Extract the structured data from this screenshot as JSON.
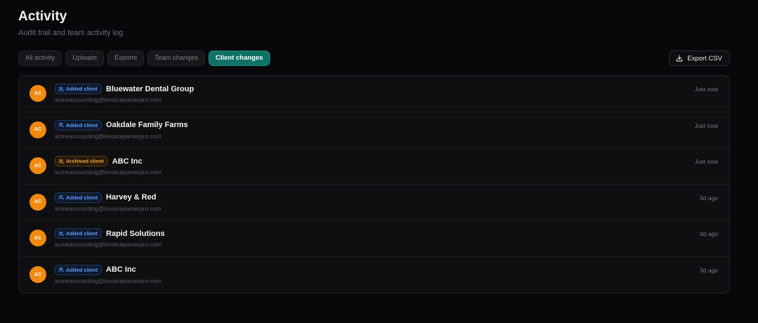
{
  "header": {
    "title": "Activity",
    "subtitle": "Audit trail and team activity log"
  },
  "filters": [
    {
      "label": "All activity",
      "active": false
    },
    {
      "label": "Uploads",
      "active": false
    },
    {
      "label": "Exports",
      "active": false
    },
    {
      "label": "Team changes",
      "active": false
    },
    {
      "label": "Client changes",
      "active": true
    }
  ],
  "export": {
    "label": "Export CSV",
    "icon": "download-icon"
  },
  "activity": [
    {
      "initials": "AC",
      "badge": "Added client",
      "badge_type": "added",
      "client": "Bluewater Dental Group",
      "email": "acmeaccounting@invoiceparserpro.com",
      "time": "Just now"
    },
    {
      "initials": "AC",
      "badge": "Added client",
      "badge_type": "added",
      "client": "Oakdale Family Farms",
      "email": "acmeaccounting@invoiceparserpro.com",
      "time": "Just now"
    },
    {
      "initials": "AC",
      "badge": "Archived client",
      "badge_type": "archived",
      "client": "ABC Inc",
      "email": "acmeaccounting@invoiceparserpro.com",
      "time": "Just now"
    },
    {
      "initials": "AC",
      "badge": "Added client",
      "badge_type": "added",
      "client": "Harvey & Red",
      "email": "acmeaccounting@invoiceparserpro.com",
      "time": "3d ago"
    },
    {
      "initials": "AC",
      "badge": "Added client",
      "badge_type": "added",
      "client": "Rapid Solutions",
      "email": "acmeaccounting@invoiceparserpro.com",
      "time": "3d ago"
    },
    {
      "initials": "AC",
      "badge": "Added client",
      "badge_type": "added",
      "client": "ABC Inc",
      "email": "acmeaccounting@invoiceparserpro.com",
      "time": "3d ago"
    }
  ],
  "colors": {
    "background": "#08080a",
    "accent": "#107266",
    "avatar": "#f28a0e",
    "badge_added": "#5e9cff",
    "badge_archived": "#f2a13a"
  }
}
